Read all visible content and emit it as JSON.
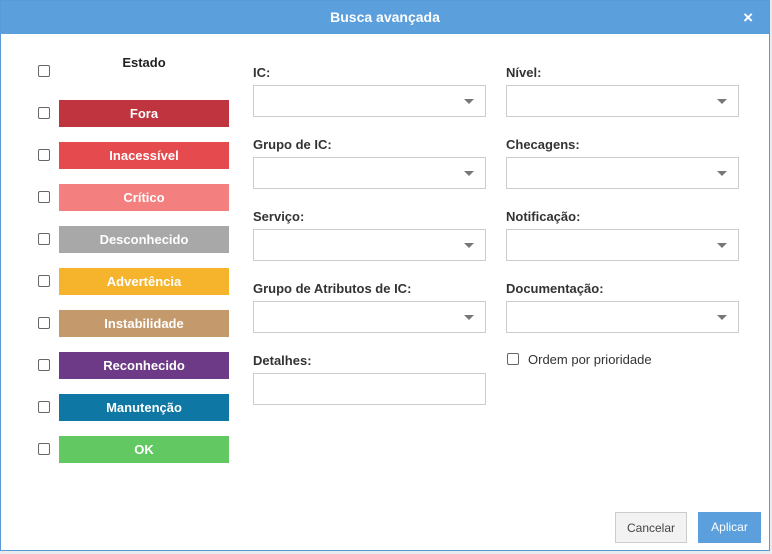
{
  "dialog": {
    "title": "Busca avançada",
    "close_icon": "×"
  },
  "states": {
    "header": "Estado",
    "items": [
      {
        "label": "Fora",
        "color": "#c0343f"
      },
      {
        "label": "Inacessível",
        "color": "#e54a4e"
      },
      {
        "label": "Crítico",
        "color": "#f47f7f"
      },
      {
        "label": "Desconhecido",
        "color": "#a8a8a8"
      },
      {
        "label": "Advertência",
        "color": "#f5b42c"
      },
      {
        "label": "Instabilidade",
        "color": "#c49a6c"
      },
      {
        "label": "Reconhecido",
        "color": "#6c3a87"
      },
      {
        "label": "Manutenção",
        "color": "#0e77a3"
      },
      {
        "label": "OK",
        "color": "#62c962"
      }
    ]
  },
  "filters": {
    "ic": {
      "label": "IC:",
      "value": ""
    },
    "ic_group": {
      "label": "Grupo de IC:",
      "value": ""
    },
    "service": {
      "label": "Serviço:",
      "value": ""
    },
    "ic_attr_group": {
      "label": "Grupo de Atributos de IC:",
      "value": ""
    },
    "details": {
      "label": "Detalhes:",
      "value": ""
    },
    "level": {
      "label": "Nível:",
      "value": ""
    },
    "checks": {
      "label": "Checagens:",
      "value": ""
    },
    "notification": {
      "label": "Notificação:",
      "value": ""
    },
    "documentation": {
      "label": "Documentação:",
      "value": ""
    }
  },
  "priority_order": {
    "label": "Ordem por prioridade",
    "checked": false
  },
  "actions": {
    "cancel": "Cancelar",
    "apply": "Aplicar"
  }
}
